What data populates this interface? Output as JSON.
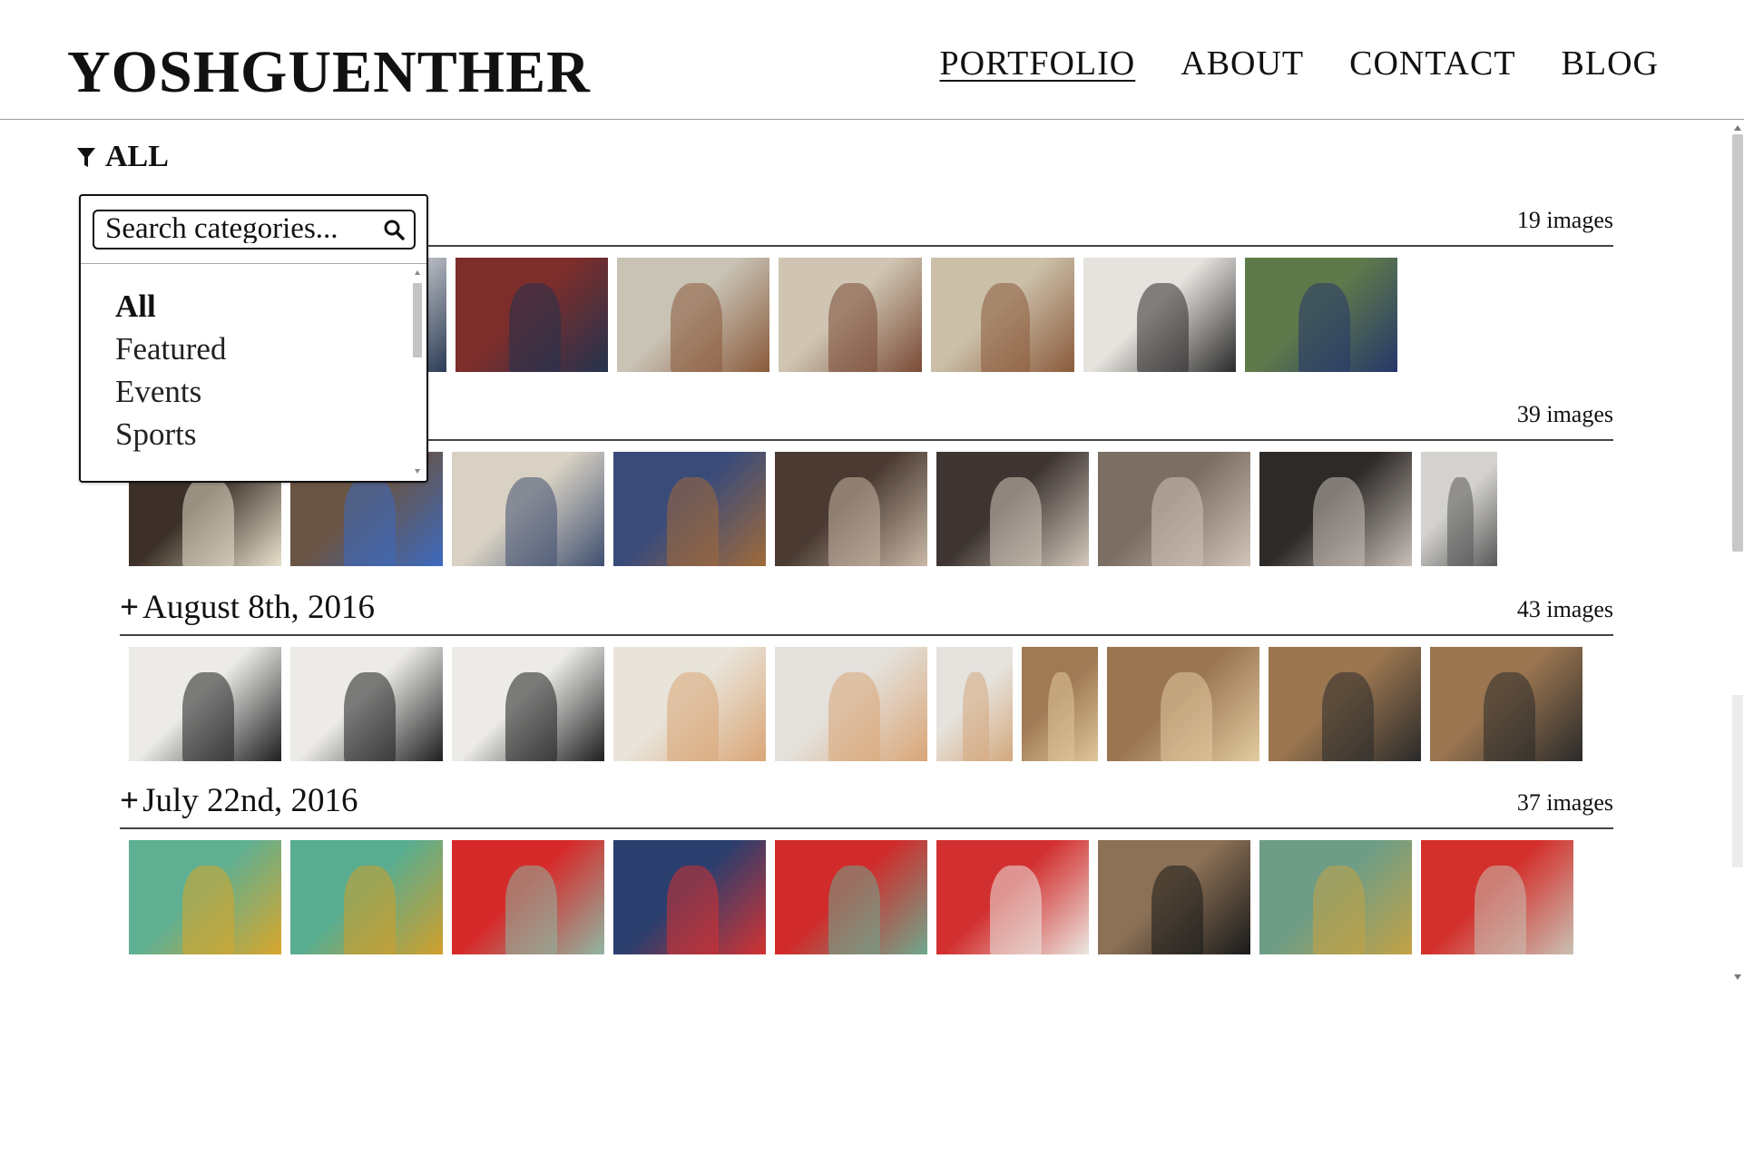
{
  "header": {
    "logo": "YOSHGUENTHER",
    "nav": [
      {
        "label": "PORTFOLIO",
        "active": true
      },
      {
        "label": "ABOUT",
        "active": false
      },
      {
        "label": "CONTACT",
        "active": false
      },
      {
        "label": "BLOG",
        "active": false
      }
    ]
  },
  "filter": {
    "label": "ALL",
    "icon": "funnel-icon",
    "dropdown": {
      "search_placeholder": "Search categories...",
      "search_icon": "magnifier-icon",
      "items": [
        {
          "label": "All",
          "selected": true
        },
        {
          "label": "Featured",
          "selected": false
        },
        {
          "label": "Events",
          "selected": false
        },
        {
          "label": "Sports",
          "selected": false
        }
      ]
    }
  },
  "albums": [
    {
      "title": "",
      "toggle": "+",
      "count": "19 images",
      "thumbs": [
        {
          "w": 172,
          "c1": "#d8d2c8",
          "c2": "#2c3344"
        },
        {
          "w": 168,
          "c1": "#c7c9cd",
          "c2": "#2b3b55"
        },
        {
          "w": 168,
          "c1": "#7e2e2a",
          "c2": "#23324f"
        },
        {
          "w": 168,
          "c1": "#c9c3b6",
          "c2": "#8a5a3a"
        },
        {
          "w": 158,
          "c1": "#cfc5b2",
          "c2": "#7a4b36"
        },
        {
          "w": 158,
          "c1": "#cbbfa8",
          "c2": "#8b5a3b"
        },
        {
          "w": 168,
          "c1": "#e6e3de",
          "c2": "#2b2a2a"
        },
        {
          "w": 168,
          "c1": "#5f7a4a",
          "c2": "#26376a"
        }
      ]
    },
    {
      "title": "",
      "toggle": "+",
      "count": "39 images",
      "thumbs": [
        {
          "w": 168,
          "c1": "#3c3028",
          "c2": "#e8e0cc"
        },
        {
          "w": 168,
          "c1": "#6a5444",
          "c2": "#3c6ac0"
        },
        {
          "w": 168,
          "c1": "#d9d2c4",
          "c2": "#3f4f70"
        },
        {
          "w": 168,
          "c1": "#3a4b7a",
          "c2": "#a06a3a"
        },
        {
          "w": 168,
          "c1": "#4a3a32",
          "c2": "#c9b8a6"
        },
        {
          "w": 168,
          "c1": "#3e3532",
          "c2": "#d4c8bb"
        },
        {
          "w": 168,
          "c1": "#7b6e62",
          "c2": "#d1c5b8"
        },
        {
          "w": 168,
          "c1": "#2e2a28",
          "c2": "#c8c0b8"
        },
        {
          "w": 84,
          "c1": "#d4d2ce",
          "c2": "#585858"
        }
      ]
    },
    {
      "title": "August 8th, 2016",
      "toggle": "+",
      "count": "43 images",
      "thumbs": [
        {
          "w": 168,
          "c1": "#ecebe8",
          "c2": "#1e1e1e"
        },
        {
          "w": 168,
          "c1": "#ecebe8",
          "c2": "#1e1e1e"
        },
        {
          "w": 168,
          "c1": "#ecebe8",
          "c2": "#1e1e1e"
        },
        {
          "w": 168,
          "c1": "#e9e4da",
          "c2": "#d9a576"
        },
        {
          "w": 168,
          "c1": "#e4e1dc",
          "c2": "#d9a576"
        },
        {
          "w": 84,
          "c1": "#e6e3de",
          "c2": "#d4a87e"
        },
        {
          "w": 84,
          "c1": "#a07a55",
          "c2": "#e0c79a"
        },
        {
          "w": 168,
          "c1": "#9a7552",
          "c2": "#e3cba0"
        },
        {
          "w": 168,
          "c1": "#9b7650",
          "c2": "#2a2a2a"
        },
        {
          "w": 168,
          "c1": "#9a7550",
          "c2": "#2a2a2a"
        }
      ]
    },
    {
      "title": "July 22nd, 2016",
      "toggle": "+",
      "count": "37 images",
      "thumbs": [
        {
          "w": 168,
          "c1": "#5fb092",
          "c2": "#d9a52a"
        },
        {
          "w": 168,
          "c1": "#58ad90",
          "c2": "#d29e2a"
        },
        {
          "w": 168,
          "c1": "#d62a2a",
          "c2": "#8fb7a3"
        },
        {
          "w": 168,
          "c1": "#2a3f6e",
          "c2": "#d33232"
        },
        {
          "w": 168,
          "c1": "#d12a2a",
          "c2": "#6fa88e"
        },
        {
          "w": 168,
          "c1": "#d23030",
          "c2": "#ebe7e1"
        },
        {
          "w": 168,
          "c1": "#8c7156",
          "c2": "#1a1a1a"
        },
        {
          "w": 168,
          "c1": "#6d9d87",
          "c2": "#c4a244"
        },
        {
          "w": 168,
          "c1": "#d3302c",
          "c2": "#c9c1b4"
        }
      ]
    }
  ]
}
